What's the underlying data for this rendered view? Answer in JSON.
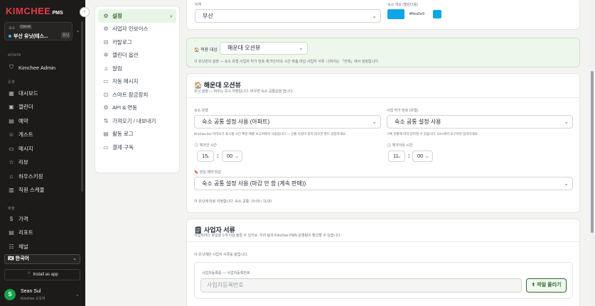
{
  "sidebar": {
    "logo": "KIMCHEE",
    "logo_suffix": "PMS",
    "toggle_icon": "chevron-left-icon",
    "toggle_glyph": "‹",
    "property": {
      "label": "숙소",
      "tag": "Ctrl+K",
      "name": "부산 유닛(테스...",
      "badge": "유닛"
    },
    "section_admin": "ADMIN",
    "admin_item": "Kimchee Admin",
    "section_ops": "운영",
    "ops_items": [
      {
        "label": "대시보드",
        "icon": "grid-icon",
        "glyph": "▦"
      },
      {
        "label": "캘린더",
        "icon": "calendar-icon",
        "glyph": "▣"
      },
      {
        "label": "예약",
        "icon": "booking-icon",
        "glyph": "▤"
      },
      {
        "label": "게스트",
        "icon": "users-icon",
        "glyph": "☺"
      },
      {
        "label": "메시지",
        "icon": "message-icon",
        "glyph": "▭"
      },
      {
        "label": "리뷰",
        "icon": "star-icon",
        "glyph": "☆"
      },
      {
        "label": "하우스키핑",
        "icon": "housekeeping-icon",
        "glyph": "⌂"
      },
      {
        "label": "직원 스케줄",
        "icon": "schedule-icon",
        "glyph": "▥"
      }
    ],
    "section_sales": "매출",
    "sales_items": [
      {
        "label": "가격",
        "icon": "dollar-icon",
        "glyph": "$"
      },
      {
        "label": "리포트",
        "icon": "report-icon",
        "glyph": "▤"
      },
      {
        "label": "채널",
        "icon": "channel-icon",
        "glyph": "☷"
      }
    ],
    "language": "🇰🇷 한국어",
    "install": "📱 Install as app",
    "user": {
      "initial": "S",
      "name": "Sean Sul",
      "role": "Kimchee 소유자"
    }
  },
  "menu": {
    "items": [
      {
        "label": "설정",
        "icon": "gear-icon",
        "glyph": "⚙",
        "active": true
      },
      {
        "label": "사업자 인보이스",
        "icon": "invoice-icon",
        "glyph": "⚙",
        "active": false
      },
      {
        "label": "카탈로그",
        "icon": "catalog-icon",
        "glyph": "⊟",
        "active": false
      },
      {
        "label": "캘린더 옵션",
        "icon": "calendar-options-icon",
        "glyph": "✲",
        "active": false
      },
      {
        "label": "알림",
        "icon": "bell-icon",
        "glyph": "♫",
        "active": false
      },
      {
        "label": "자동 메시지",
        "icon": "auto-message-icon",
        "glyph": "▭",
        "active": false
      },
      {
        "label": "스마트 잠금장치",
        "icon": "lock-icon",
        "glyph": "⊡",
        "active": false
      },
      {
        "label": "API & 연동",
        "icon": "api-icon",
        "glyph": "⚙",
        "active": false
      },
      {
        "label": "가져오기 / 내보내기",
        "icon": "import-export-icon",
        "glyph": "⇅",
        "active": false
      },
      {
        "label": "활동 로그",
        "icon": "activity-log-icon",
        "glyph": "▤",
        "active": false
      },
      {
        "label": "결제·구독",
        "icon": "billing-icon",
        "glyph": "▭",
        "active": false
      }
    ],
    "active_arrow": "›"
  },
  "region_card": {
    "region_label": "지역",
    "region_value": "부산",
    "color_label": "숙소 색상 (캘린더용)",
    "color_hex": "#0ea5e9",
    "color_text": "#0ea5e9"
  },
  "scope_card": {
    "label": "🏠 적용 대상",
    "value": "해운대 오션뷰",
    "hint": "이 유닛만의 설정 — 숙소 유형·사업자 허가 번호·체크인/아웃 시간·맞춤 마감·사업자 서류. 나머지는 「전체」에서 설정합니다."
  },
  "unit_card": {
    "title": "🏠 해운대 오션뷰",
    "subtitle": "유닛 설정 — 비우는 즉시 저장됩니다. 비우면 숙소 공통값을 씁니다.",
    "type_label": "숙소 유형",
    "type_value": "숙소 공통 설정 사용 (아파트)",
    "type_hint": "kimchee.live 미리보기·표시될 시간 확장·매출 보고서에서 사용됩니다 — 공통 유형이 맞지 않으면 별도 설정하세요.",
    "permit_label": "사업 허가 번호 (유형)",
    "permit_value": "숙소 공통 설정 사용",
    "permit_hint": "기록 현황에 따라 달라질 수 있습니다. OTA에서 요구하면 입력하세요.",
    "checkin_label": "🕒 체크인 시간",
    "checkin_hour": "15",
    "checkin_min": "00",
    "checkout_label": "🕒 체크아웃 시간",
    "checkout_hour": "11",
    "checkout_min": "00",
    "cutoff_label": "🔖 당일 예약 마감",
    "cutoff_value": "숙소 공통 설정 사용 (마감 안 함 (계속 판매))",
    "footer_hint": "이 유닛에 따로 지정합니다. 숙소 공통: 15:00 / 11:00"
  },
  "docs_card": {
    "title": "🗒 사업자 서류",
    "subtitle": "사업자마다 파일을 1개 이상 올릴 수 있어요. 우리 팀과 Kimchee PMS 운영팀이 확인할 수 있습니다.",
    "note": "이 유닛에만 사업자 서류를 올립니다.",
    "field_label": "사업자등록증 — 사업자등록번호",
    "placeholder": "사업자등록번호",
    "upload_label": "⬆ 파일 올리기"
  }
}
